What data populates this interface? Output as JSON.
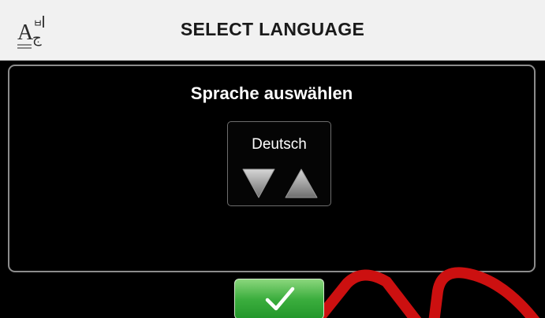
{
  "header": {
    "title": "SELECT LANGUAGE",
    "icon": "language-icon"
  },
  "panel": {
    "subtitle": "Sprache auswählen",
    "selector": {
      "selected_language": "Deutsch",
      "down_icon": "triangle-down-icon",
      "up_icon": "triangle-up-icon"
    }
  },
  "footer": {
    "confirm_icon": "checkmark-icon"
  },
  "colors": {
    "header_bg": "#f1f1f1",
    "panel_border": "#8c8c8c",
    "confirm_green": "#3cae3e",
    "watermark_red": "#cc1010"
  }
}
